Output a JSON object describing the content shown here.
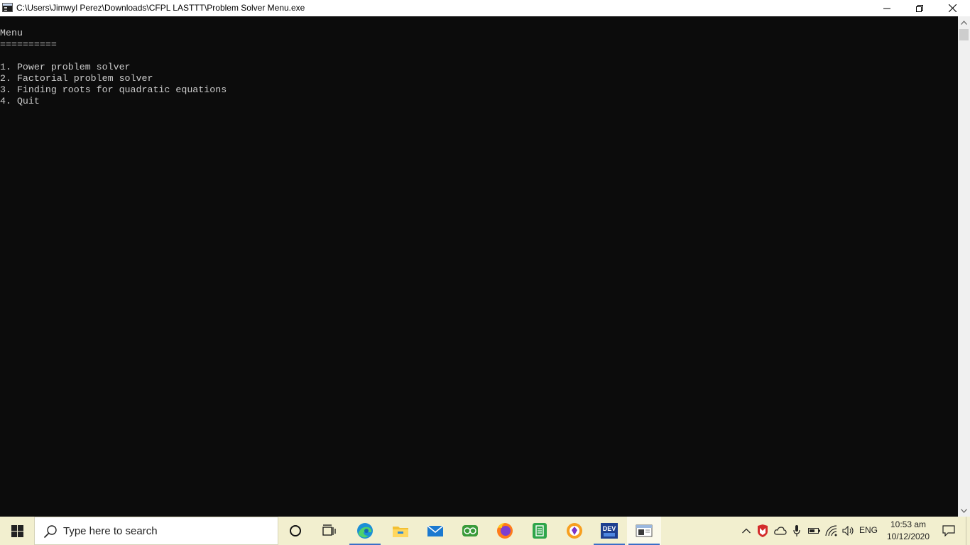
{
  "window": {
    "title": "C:\\Users\\Jimwyl Perez\\Downloads\\CFPL  LASTTT\\Problem Solver Menu.exe"
  },
  "console": {
    "lines": [
      "Menu",
      "==========",
      "1. Power problem solver",
      "2. Factorial problem solver",
      "3. Finding roots for quadratic equations",
      "4. Quit"
    ],
    "background": "#0c0c0c",
    "foreground": "#cccccc"
  },
  "taskbar": {
    "search_placeholder": "Type here to search",
    "pinned": [
      "cortana-icon",
      "task-view-icon",
      "edge-icon",
      "file-explorer-icon",
      "mail-icon",
      "game-controller-app-icon",
      "firefox-icon",
      "evernote-icon",
      "avast-browser-icon",
      "dev-cpp-icon",
      "console-window-icon"
    ],
    "tray": {
      "language": "ENG",
      "time": "10:53 am",
      "date": "10/12/2020"
    },
    "background": "#f2efcf"
  }
}
